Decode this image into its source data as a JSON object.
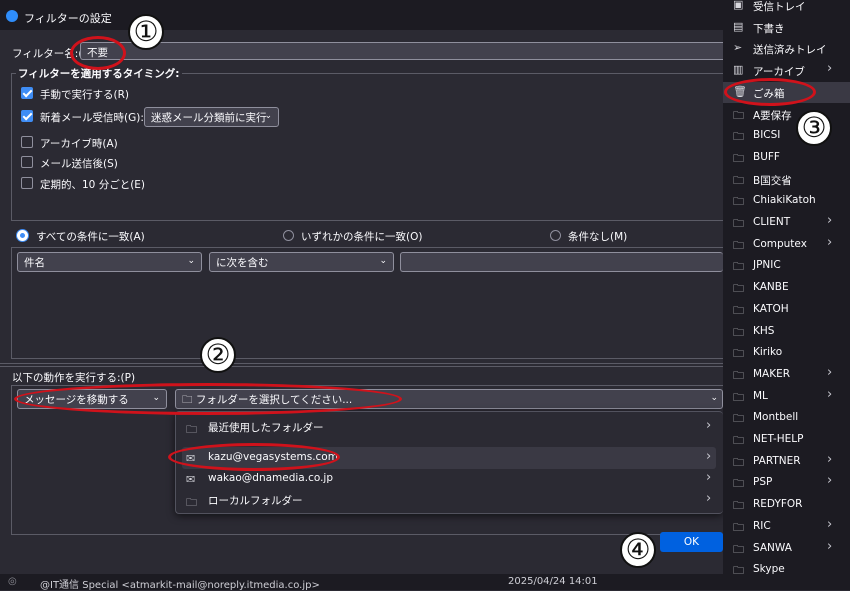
{
  "dialog": {
    "title": "フィルターの設定",
    "filter_name_label": "フィルター名:(",
    "filter_name_value": "不要",
    "timing_legend": "フィルターを適用するタイミング:",
    "timing_options": [
      {
        "label": "手動で実行する(R)",
        "checked": true
      },
      {
        "label": "新着メール受信時(G):",
        "checked": true
      },
      {
        "label": "アーカイブ時(A)",
        "checked": false
      },
      {
        "label": "メール送信後(S)",
        "checked": false
      },
      {
        "label": "定期的、10 分ごと(E)",
        "checked": false
      }
    ],
    "new_mail_select": "迷惑メール分類前に実行",
    "match_all": "すべての条件に一致(A)",
    "match_any": "いずれかの条件に一致(O)",
    "match_none": "条件なし(M)",
    "condition_field": "件名",
    "condition_operator": "に次を含む",
    "actions_label": "以下の動作を実行する:(P)",
    "action_select": "メッセージを移動する",
    "folder_select": "フォルダーを選択してください...",
    "ok_label": "OK"
  },
  "folder_popup": {
    "items": [
      {
        "label": "最近使用したフォルダー",
        "icon": "folder-icon",
        "submenu": true
      },
      {
        "label": "kazu@vegasystems.com",
        "icon": "mail-account-icon",
        "submenu": true
      },
      {
        "label": "wakao@dnamedia.co.jp",
        "icon": "mail-account-icon",
        "submenu": true
      },
      {
        "label": "ローカルフォルダー",
        "icon": "folder-icon",
        "submenu": true
      }
    ]
  },
  "right_panel": {
    "items": [
      {
        "label": "受信トレイ",
        "icon": "inbox-icon",
        "submenu": false
      },
      {
        "label": "下書き",
        "icon": "draft-icon",
        "submenu": false
      },
      {
        "label": "送信済みトレイ",
        "icon": "sent-icon",
        "submenu": false
      },
      {
        "label": "アーカイブ",
        "icon": "archive-icon",
        "submenu": true
      },
      {
        "label": "ごみ箱",
        "icon": "trash-icon",
        "submenu": false
      },
      {
        "label": "A要保存",
        "icon": "folder-icon",
        "submenu": false
      },
      {
        "label": "BICSI",
        "icon": "folder-icon",
        "submenu": false
      },
      {
        "label": "BUFF",
        "icon": "folder-icon",
        "submenu": false
      },
      {
        "label": "B国交省",
        "icon": "folder-icon",
        "submenu": false
      },
      {
        "label": "ChiakiKatoh",
        "icon": "folder-icon",
        "submenu": false
      },
      {
        "label": "CLIENT",
        "icon": "folder-icon",
        "submenu": true
      },
      {
        "label": "Computex",
        "icon": "folder-icon",
        "submenu": true
      },
      {
        "label": "JPNIC",
        "icon": "folder-icon",
        "submenu": false
      },
      {
        "label": "KANBE",
        "icon": "folder-icon",
        "submenu": false
      },
      {
        "label": "KATOH",
        "icon": "folder-icon",
        "submenu": false
      },
      {
        "label": "KHS",
        "icon": "folder-icon",
        "submenu": false
      },
      {
        "label": "Kiriko",
        "icon": "folder-icon",
        "submenu": false
      },
      {
        "label": "MAKER",
        "icon": "folder-icon",
        "submenu": true
      },
      {
        "label": "ML",
        "icon": "folder-icon",
        "submenu": true
      },
      {
        "label": "Montbell",
        "icon": "folder-icon",
        "submenu": false
      },
      {
        "label": "NET-HELP",
        "icon": "folder-icon",
        "submenu": false
      },
      {
        "label": "PARTNER",
        "icon": "folder-icon",
        "submenu": true
      },
      {
        "label": "PSP",
        "icon": "folder-icon",
        "submenu": true
      },
      {
        "label": "REDYFOR",
        "icon": "folder-icon",
        "submenu": false
      },
      {
        "label": "RIC",
        "icon": "folder-icon",
        "submenu": true
      },
      {
        "label": "SANWA",
        "icon": "folder-icon",
        "submenu": true
      },
      {
        "label": "Skype",
        "icon": "folder-icon",
        "submenu": false
      }
    ]
  },
  "annotations": [
    "①",
    "②",
    "③",
    "④"
  ],
  "footer": {
    "sender": "@IT通信 Special <atmarkit-mail@noreply.itmedia.co.jp>",
    "date": "2025/04/24 14:01"
  },
  "colors": {
    "accent": "#0061e0",
    "annotation": "#d0121b",
    "background": "#2b2a33"
  }
}
